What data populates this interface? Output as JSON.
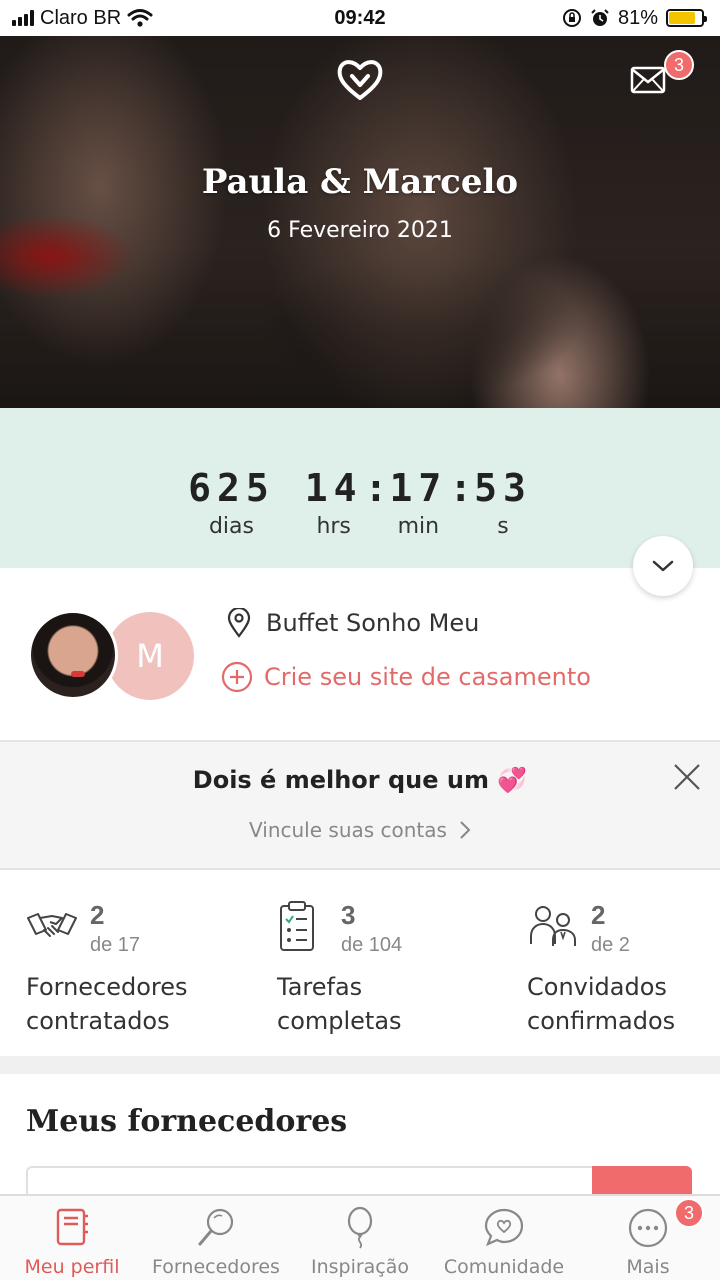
{
  "status_bar": {
    "carrier": "Claro BR",
    "time": "09:42",
    "battery_percent": "81%",
    "battery_level": 0.81
  },
  "hero": {
    "couple_name": "Paula & Marcelo",
    "date": "6 Fevereiro 2021",
    "messages_badge": "3"
  },
  "countdown": {
    "days": {
      "value": "625",
      "label": "dias"
    },
    "hours": {
      "value": "14",
      "label": "hrs"
    },
    "minutes": {
      "value": "17",
      "label": "min"
    },
    "seconds": {
      "value": "53",
      "label": "s"
    },
    "separator": ":"
  },
  "profile": {
    "partner_initial": "M",
    "venue": "Buffet Sonho Meu",
    "create_site_label": "Crie seu site de casamento"
  },
  "link_accounts": {
    "title": "Dois é melhor que um 💞",
    "subtitle": "Vincule suas contas"
  },
  "stats": [
    {
      "count": "2",
      "total": "de 17",
      "label_line1": "Fornecedores",
      "label_line2": "contratados",
      "icon": "handshake-icon"
    },
    {
      "count": "3",
      "total": "de 104",
      "label_line1": "Tarefas",
      "label_line2": "completas",
      "icon": "checklist-icon"
    },
    {
      "count": "2",
      "total": "de 2",
      "label_line1": "Convidados",
      "label_line2": "confirmados",
      "icon": "guests-icon"
    }
  ],
  "suppliers": {
    "title": "Meus fornecedores"
  },
  "bottom_nav": {
    "items": [
      {
        "label": "Meu perfil",
        "icon": "profile-notebook-icon",
        "active": true
      },
      {
        "label": "Fornecedores",
        "icon": "search-icon"
      },
      {
        "label": "Inspiração",
        "icon": "balloon-icon"
      },
      {
        "label": "Comunidade",
        "icon": "chat-heart-icon"
      },
      {
        "label": "Mais",
        "icon": "more-icon"
      }
    ],
    "more_badge": "3"
  },
  "colors": {
    "accent": "#e05a5a",
    "badge": "#f06b6b",
    "countdown_bg": "#dff0ea",
    "avatar_bg": "#f0c1bd"
  }
}
